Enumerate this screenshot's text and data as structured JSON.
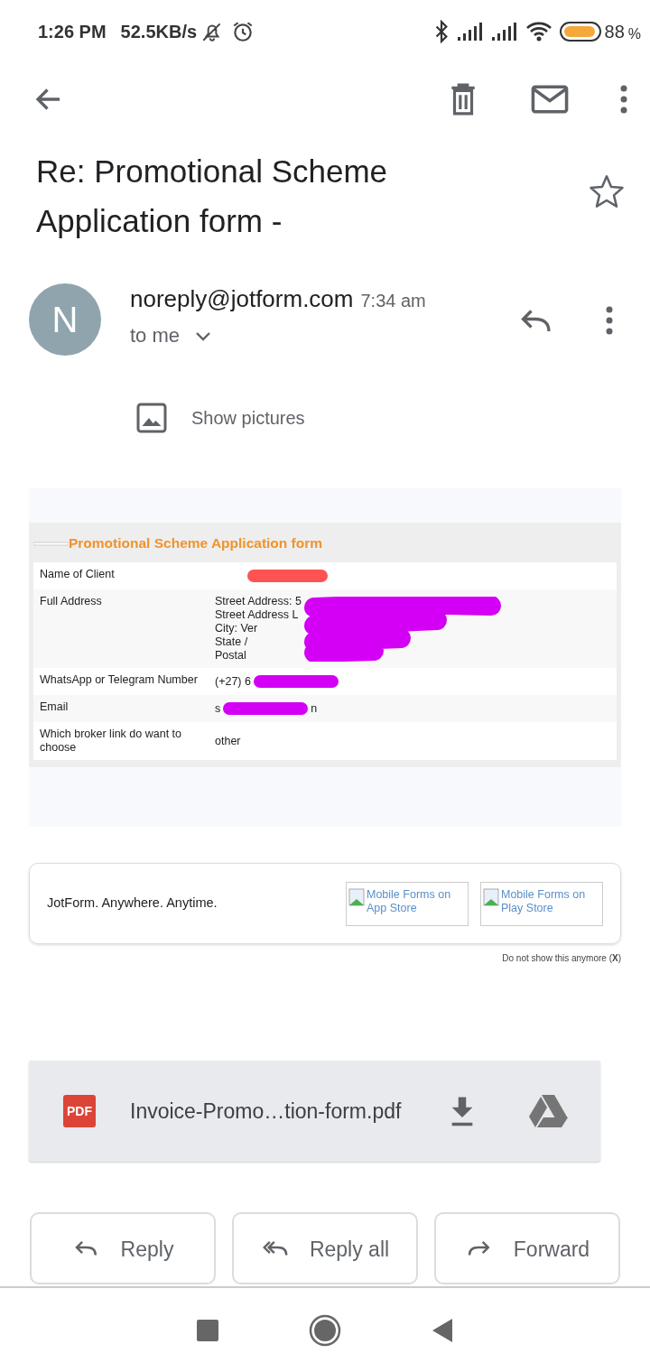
{
  "status_bar": {
    "time": "1:26 PM",
    "speed": "52.5KB/s",
    "battery": "88",
    "battery_unit": "%"
  },
  "subject": "Re: Promotional Scheme Application form -",
  "starred": false,
  "sender": {
    "avatar": "N",
    "address": "noreply@jotform.com",
    "time": "7:34 am",
    "recipient": "to me"
  },
  "show_pictures": "Show pictures",
  "form": {
    "title": "Promotional Scheme Application form",
    "rows": [
      {
        "label": "Name of Client",
        "value_lines": [],
        "redaction": {
          "color": "#ff5252"
        }
      },
      {
        "label": "Full Address",
        "value_lines": [
          "Street Address: 5",
          "Street Address L",
          "City: Ver",
          "State /",
          "Postal"
        ],
        "redaction": {
          "color": "#d400f5"
        }
      },
      {
        "label": "WhatsApp or Telegram Number",
        "value_lines": [
          "(+27) 6"
        ],
        "redaction": {
          "color": "#d400f5"
        }
      },
      {
        "label": "Email",
        "value_lines": [
          "s"
        ],
        "value_after": "n",
        "redaction": {
          "color": "#d400f5"
        }
      },
      {
        "label": "Which broker link do want to choose",
        "value_lines": [
          "other"
        ]
      }
    ]
  },
  "banner": {
    "text": "JotForm. Anywhere. Anytime.",
    "badges": [
      "Mobile Forms on App Store",
      "Mobile Forms on Play Store"
    ],
    "dismiss": "Do not show this anymore (**X**)"
  },
  "attachment": {
    "type": "PDF",
    "name": "Invoice-Promo…tion-form.pdf"
  },
  "actions": [
    {
      "kind": "reply",
      "label": "Reply"
    },
    {
      "kind": "reply_all",
      "label": "Reply all"
    },
    {
      "kind": "forward",
      "label": "Forward"
    }
  ]
}
